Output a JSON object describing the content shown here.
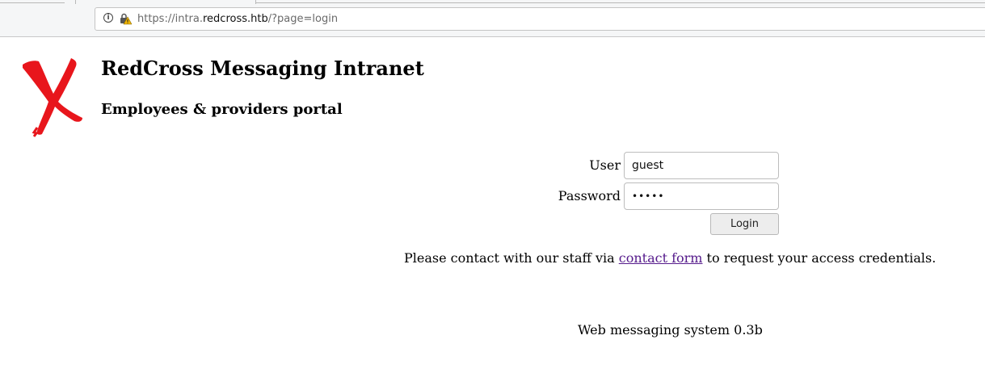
{
  "browser": {
    "url_prefix": "https://intra.",
    "url_domain": "redcross.htb",
    "url_suffix": "/?page=login"
  },
  "header": {
    "title": "RedCross Messaging Intranet",
    "subtitle": "Employees & providers portal",
    "logo_icon": "red-x-logo-icon",
    "logo_color": "#e8161c"
  },
  "login": {
    "user_label": "User",
    "user_value": "guest",
    "password_label": "Password",
    "password_value": "•••••",
    "button_label": "Login"
  },
  "contact": {
    "before": "Please contact with our staff via",
    "link": "contact form",
    "after": "to request your access credentials."
  },
  "footer": {
    "text": "Web messaging system 0.3b"
  }
}
